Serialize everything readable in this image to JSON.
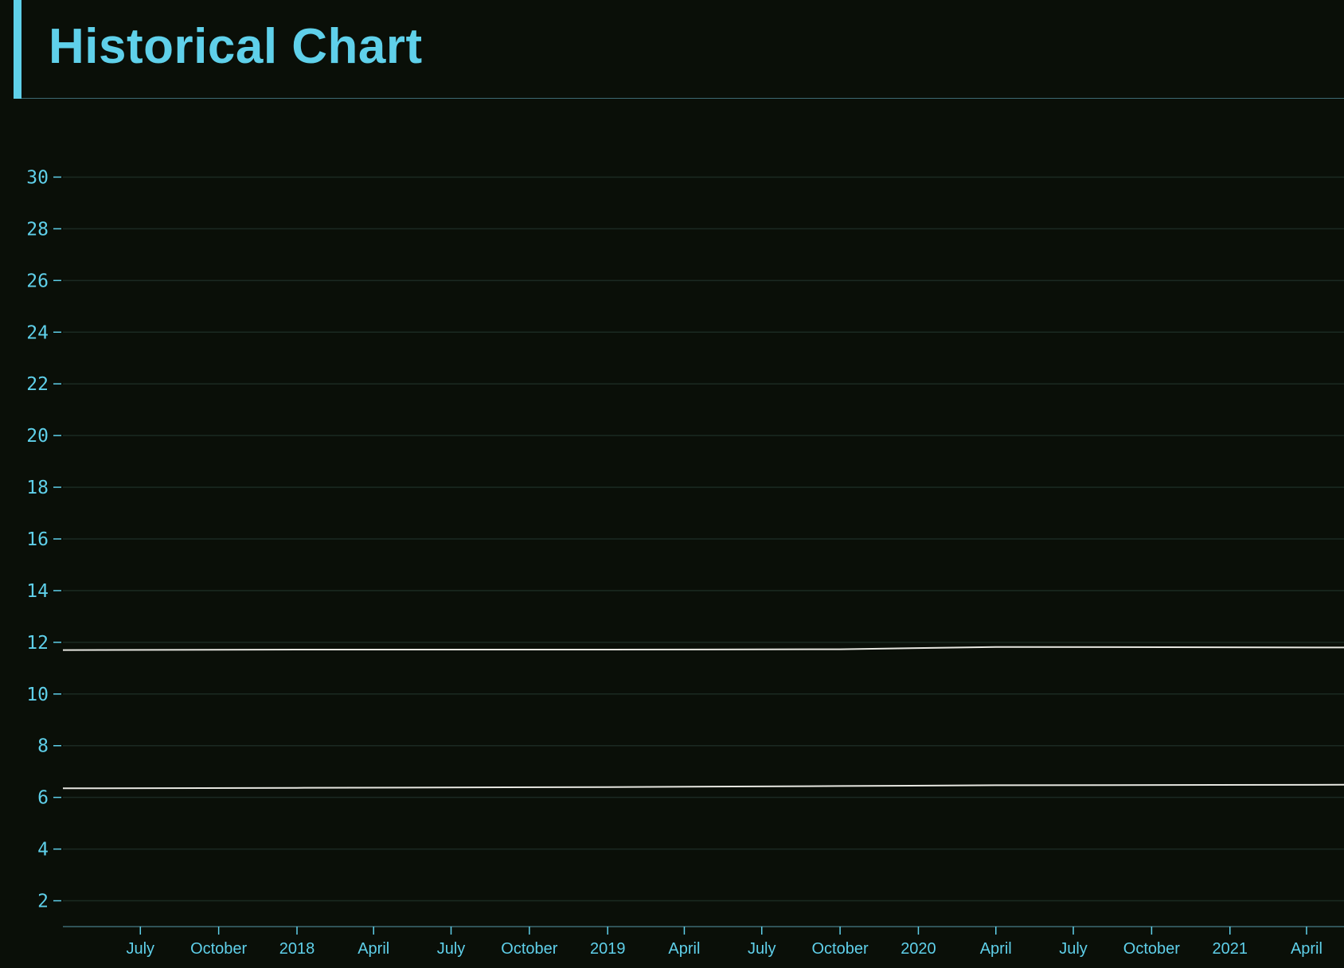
{
  "header": {
    "title": "Historical Chart"
  },
  "colors": {
    "background": "#0a0f08",
    "accent": "#5fd0ea",
    "gridline": "#1b2a22",
    "series_line": "#e6e6e0"
  },
  "chart_data": {
    "type": "line",
    "title": "Historical Chart",
    "xlabel": "",
    "ylabel": "",
    "ylim": [
      1,
      31
    ],
    "xlim": [
      "2017-04-01",
      "2021-05-15"
    ],
    "grid": true,
    "yticks": [
      2,
      4,
      6,
      8,
      10,
      12,
      14,
      16,
      18,
      20,
      22,
      24,
      26,
      28,
      30
    ],
    "xticks": [
      {
        "date": "2017-07-01",
        "label": "July"
      },
      {
        "date": "2017-10-01",
        "label": "October"
      },
      {
        "date": "2018-01-01",
        "label": "2018"
      },
      {
        "date": "2018-04-01",
        "label": "April"
      },
      {
        "date": "2018-07-01",
        "label": "July"
      },
      {
        "date": "2018-10-01",
        "label": "October"
      },
      {
        "date": "2019-01-01",
        "label": "2019"
      },
      {
        "date": "2019-04-01",
        "label": "April"
      },
      {
        "date": "2019-07-01",
        "label": "July"
      },
      {
        "date": "2019-10-01",
        "label": "October"
      },
      {
        "date": "2020-01-01",
        "label": "2020"
      },
      {
        "date": "2020-04-01",
        "label": "April"
      },
      {
        "date": "2020-07-01",
        "label": "July"
      },
      {
        "date": "2020-10-01",
        "label": "October"
      },
      {
        "date": "2021-01-01",
        "label": "2021"
      },
      {
        "date": "2021-04-01",
        "label": "April"
      }
    ],
    "series": [
      {
        "x": [
          "2017-04-01",
          "2018-01-01",
          "2019-01-01",
          "2019-10-01",
          "2020-04-01",
          "2021-05-15"
        ],
        "values": [
          11.7,
          11.72,
          11.72,
          11.73,
          11.82,
          11.8
        ]
      },
      {
        "x": [
          "2017-04-01",
          "2018-01-01",
          "2019-01-01",
          "2019-10-01",
          "2020-04-01",
          "2021-05-15"
        ],
        "values": [
          6.35,
          6.37,
          6.4,
          6.44,
          6.47,
          6.49
        ]
      }
    ]
  }
}
